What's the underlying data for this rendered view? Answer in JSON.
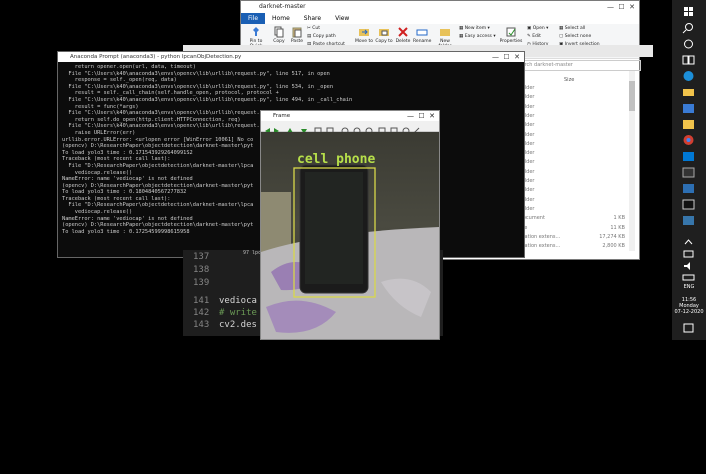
{
  "explorer": {
    "title": "darknet-master",
    "tabs": [
      "File",
      "Home",
      "Share",
      "View"
    ],
    "ribbon": {
      "pin": "Pin to Quick access",
      "copy": "Copy",
      "paste": "Paste",
      "cut": "Cut",
      "copy_path": "Copy path",
      "paste_shortcut": "Paste shortcut",
      "move_to": "Move to",
      "copy_to": "Copy to",
      "delete": "Delete",
      "rename": "Rename",
      "new_folder": "New folder",
      "new_item": "New item",
      "easy_access": "Easy access",
      "properties": "Properties",
      "open": "Open",
      "edit": "Edit",
      "history": "History",
      "select_all": "Select all",
      "select_none": "Select none",
      "invert_selection": "Invert selection",
      "select_group": "Select"
    },
    "search_placeholder": "Search darknet-master",
    "column_size": "Size",
    "rows": [
      {
        "type": "Folder",
        "size": ""
      },
      {
        "type": "Folder",
        "size": ""
      },
      {
        "type": "Folder",
        "size": ""
      },
      {
        "type": "Folder",
        "size": ""
      },
      {
        "type": "Folder",
        "size": ""
      },
      {
        "type": "Folder",
        "size": ""
      },
      {
        "type": "Folder",
        "size": ""
      },
      {
        "type": "Folder",
        "size": ""
      },
      {
        "type": "Folder",
        "size": ""
      },
      {
        "type": "Folder",
        "size": ""
      },
      {
        "type": "Folder",
        "size": ""
      },
      {
        "type": "Folder",
        "size": ""
      },
      {
        "type": "Folder",
        "size": ""
      },
      {
        "type": "Folder",
        "size": ""
      },
      {
        "type": "Document",
        "size": "1 KB"
      },
      {
        "type": "File",
        "size": "11 KB"
      },
      {
        "type": "lication extens...",
        "size": "17,274 KB"
      },
      {
        "type": "lication extens...",
        "size": "2,800 KB"
      }
    ]
  },
  "python": {
    "title": "Anaconda Prompt (anaconda3) - python  lpcanObjDetection.py",
    "lines": [
      "    return opener.open(url, data, timeout)",
      "  File \"C:\\Users\\k40\\anaconda3\\envs\\opencv\\lib\\urllib\\request.py\", line 517, in open",
      "    response = self._open(req, data)",
      "  File \"C:\\Users\\k40\\anaconda3\\envs\\opencv\\lib\\urllib\\request.py\", line 534, in _open",
      "    result = self._call_chain(self.handle_open, protocol, protocol +",
      "  File \"C:\\Users\\k40\\anaconda3\\envs\\opencv\\lib\\urllib\\request.py\", line 494, in _call_chain",
      "    result = func(*args)",
      "  File \"C:\\Users\\k40\\anaconda3\\envs\\opencv\\lib\\urllib\\request.py\", line 1375, in http_open",
      "    return self.do_open(http.client.HTTPConnection, req)",
      "  File \"C:\\Users\\k40\\anaconda3\\envs\\opencv\\lib\\urllib\\request.py\", line 1349, in do_open",
      "    raise URLError(err)",
      "urllib.error.URLError: <urlopen error [WinError 10061] No co                                     tively refused it>",
      "",
      "(opencv) D:\\ResearchPaper\\objectdetection\\darknet-master\\pyt",
      "To load yolo3 time : 0.1715439292640991S2",
      "Traceback (most recent call last):",
      "  File \"D:\\ResearchPaper\\objectdetection\\darknet-master\\lpca",
      "    vediocap.release()",
      "NameError: name 'vediocap' is not defined",
      "",
      "(opencv) D:\\ResearchPaper\\objectdetection\\darknet-master\\pyt",
      "To load yolo3 time : 0.1804840567277832",
      "Traceback (most recent call last):",
      "  File \"D:\\ResearchPaper\\objectdetection\\darknet-master\\lpca",
      "    vediocap.release()",
      "NameError: name 'vediocap' is not defined",
      "",
      "(opencv) D:\\ResearchPaper\\objectdetection\\darknet-master\\pyt",
      "To load yolo3 time : 0.17254599998615958"
    ]
  },
  "vscode": {
    "line_numbers": [
      "137",
      "138",
      "139",
      "140",
      "141",
      "142",
      "143"
    ],
    "code_141": "vedioca",
    "code_142": "# write",
    "code_143": "cv2.des",
    "tab_fragment": "97  lpca"
  },
  "frame": {
    "title": "Frame",
    "detection_label": "cell phone"
  },
  "taskbar": {
    "language": "ENG",
    "time": "11:56",
    "day": "Monday",
    "date": "07-12-2020"
  }
}
